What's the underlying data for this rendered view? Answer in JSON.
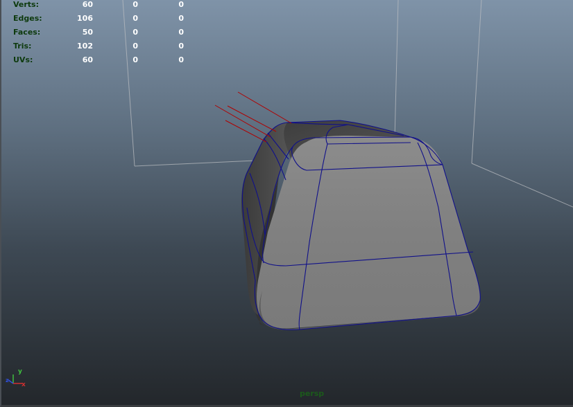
{
  "hud": {
    "rows": [
      {
        "label": "Verts:",
        "v1": "60",
        "v2": "0",
        "v3": "0"
      },
      {
        "label": "Edges:",
        "v1": "106",
        "v2": "0",
        "v3": "0"
      },
      {
        "label": "Faces:",
        "v1": "50",
        "v2": "0",
        "v3": "0"
      },
      {
        "label": "Tris:",
        "v1": "102",
        "v2": "0",
        "v3": "0"
      },
      {
        "label": "UVs:",
        "v1": "60",
        "v2": "0",
        "v3": "0"
      }
    ]
  },
  "viewport": {
    "camera_label": "persp",
    "axis": {
      "y": "y",
      "x": "x",
      "z": "z"
    }
  },
  "colors": {
    "wire": "#10108a",
    "grid": "#c8c8c8",
    "normals": "#b00000",
    "hud_label": "#0d3a0d",
    "camera_label": "#1b5a1b"
  }
}
